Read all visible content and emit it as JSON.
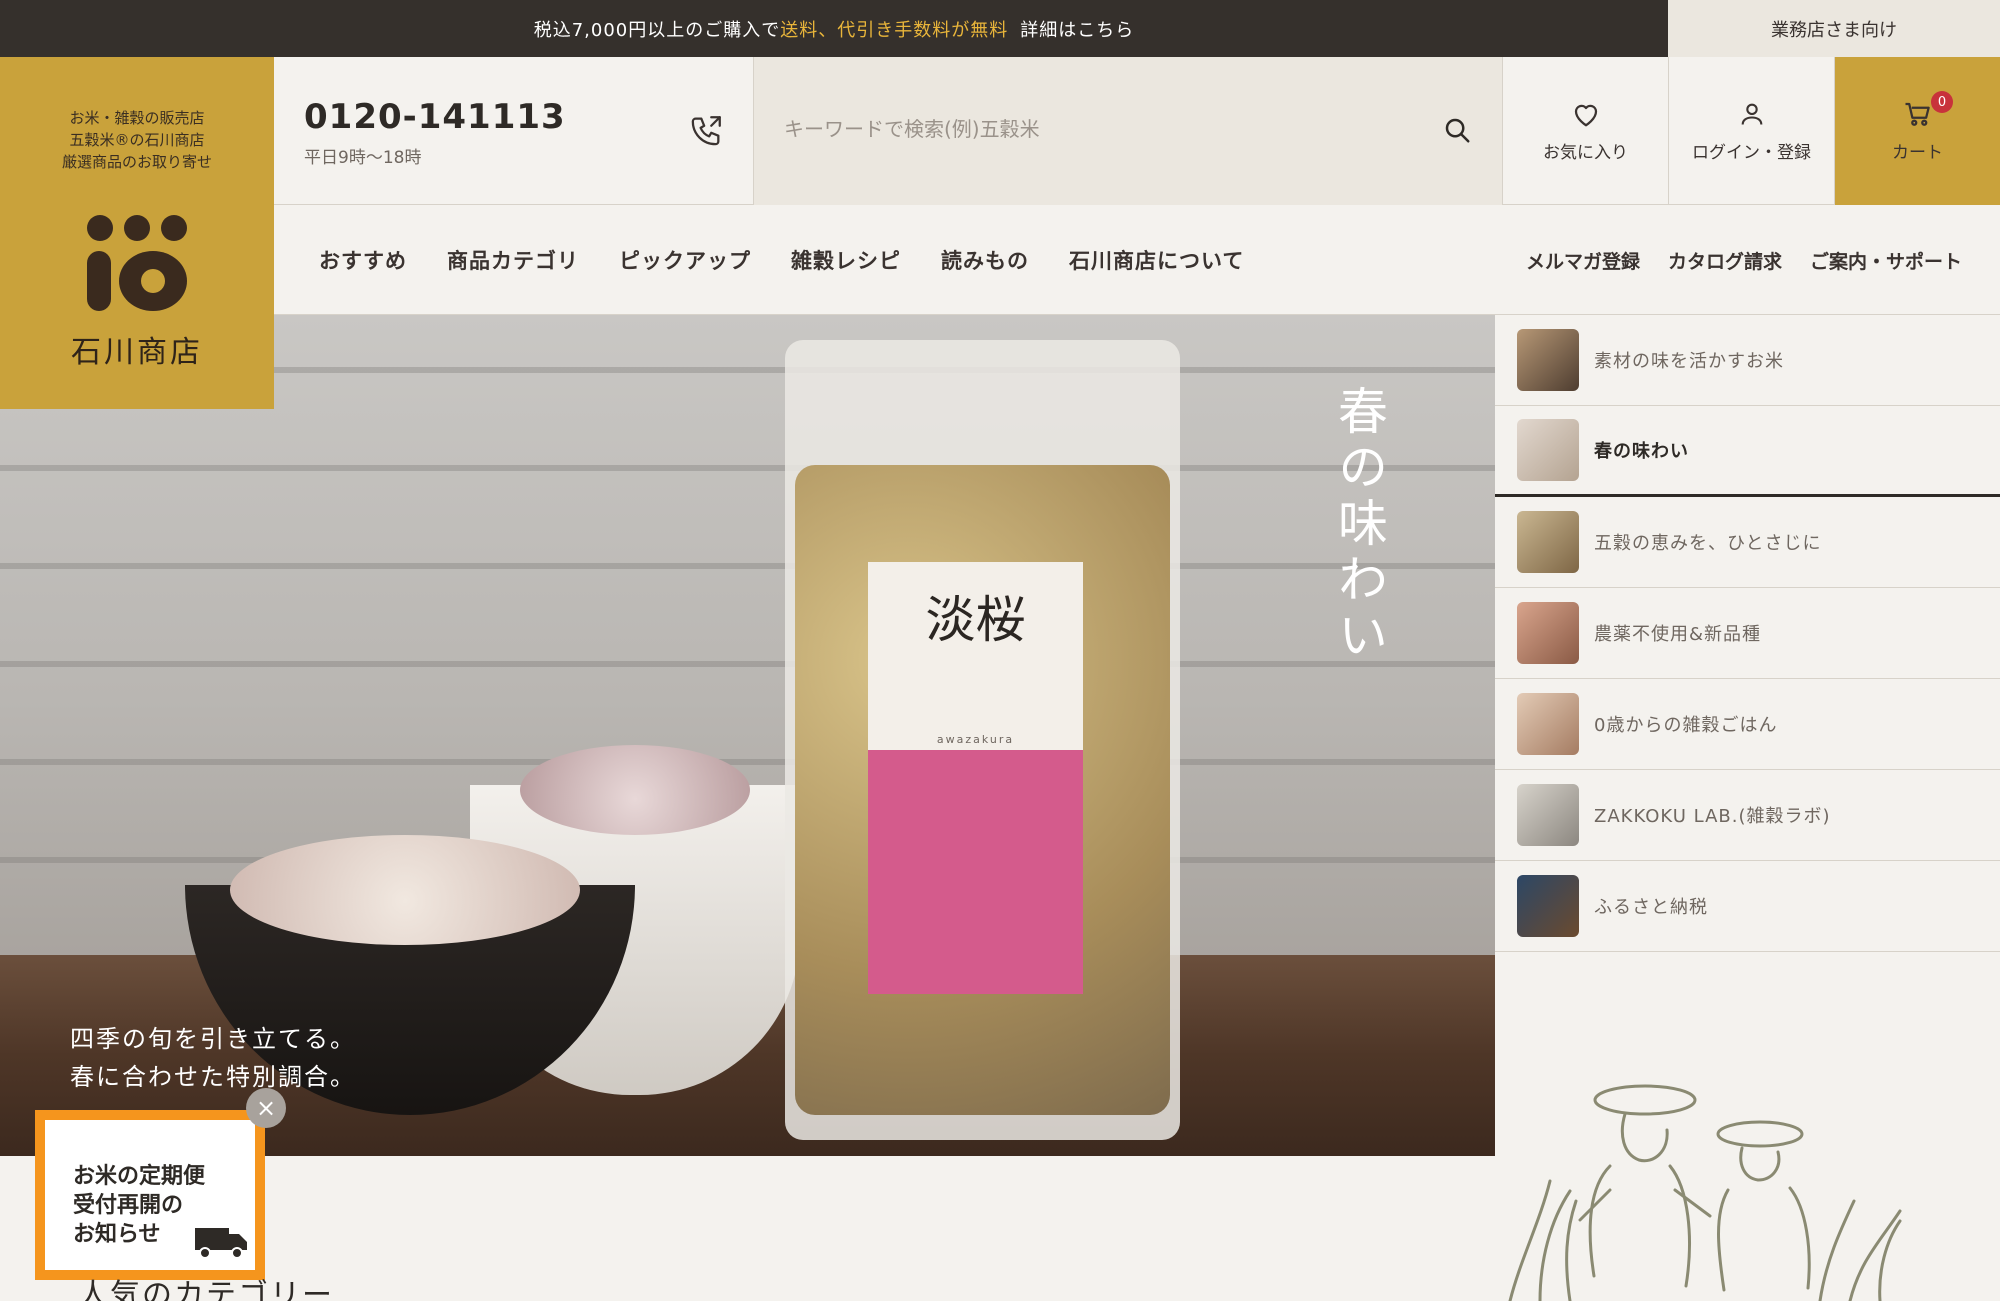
{
  "topbar": {
    "msg_prefix": "税込7,000円以上のご購入で",
    "msg_highlight": "送料、代引き手数料が無料",
    "msg_link": "詳細はこちら",
    "business_label": "業務店さま向け",
    "highlight_color": "#e9b53a"
  },
  "logo": {
    "tagline_1": "お米・雑穀の販売店",
    "tagline_2": "五穀米®の石川商店",
    "tagline_3": "厳選商品のお取り寄せ",
    "name": "石川商店",
    "bg_color": "#c9a23b"
  },
  "header": {
    "phone_number": "0120-141113",
    "phone_hours": "平日9時〜18時",
    "search_placeholder": "キーワードで検索(例)五穀米",
    "favorites_label": "お気に入り",
    "login_label": "ログイン・登録",
    "cart_label": "カート",
    "cart_count": "0",
    "icons": {
      "phone": "phone-icon",
      "search": "search-icon",
      "favorites": "heart-icon",
      "login": "user-icon",
      "cart": "cart-icon"
    }
  },
  "nav": {
    "main": [
      "おすすめ",
      "商品カテゴリ",
      "ピックアップ",
      "雑穀レシピ",
      "読みもの",
      "石川商店について"
    ],
    "sub": [
      "メルマガ登録",
      "カタログ請求",
      "ご案内・サポート"
    ]
  },
  "hero": {
    "vertical_text": "春の味わい",
    "caption_1": "四季の旬を引き立てる。",
    "caption_2": "春に合わせた特別調合。",
    "product_label": "淡桜",
    "product_roman": "awazakura"
  },
  "side_list": {
    "active_index": 1,
    "items": [
      {
        "label": "素材の味を活かすお米"
      },
      {
        "label": "春の味わい"
      },
      {
        "label": "五穀の恵みを、ひとさじに"
      },
      {
        "label": "農薬不使用&新品種"
      },
      {
        "label": "0歳からの雑穀ごはん"
      },
      {
        "label": "ZAKKOKU LAB.(雑穀ラボ)"
      },
      {
        "label": "ふるさと納税"
      }
    ]
  },
  "popup": {
    "line_1": "お米の定期便",
    "line_2": "受付再開の",
    "line_3": "お知らせ",
    "close_label": "×",
    "border_color": "#f5951d"
  },
  "sections": {
    "popular_heading": "人気のカテゴリー"
  }
}
